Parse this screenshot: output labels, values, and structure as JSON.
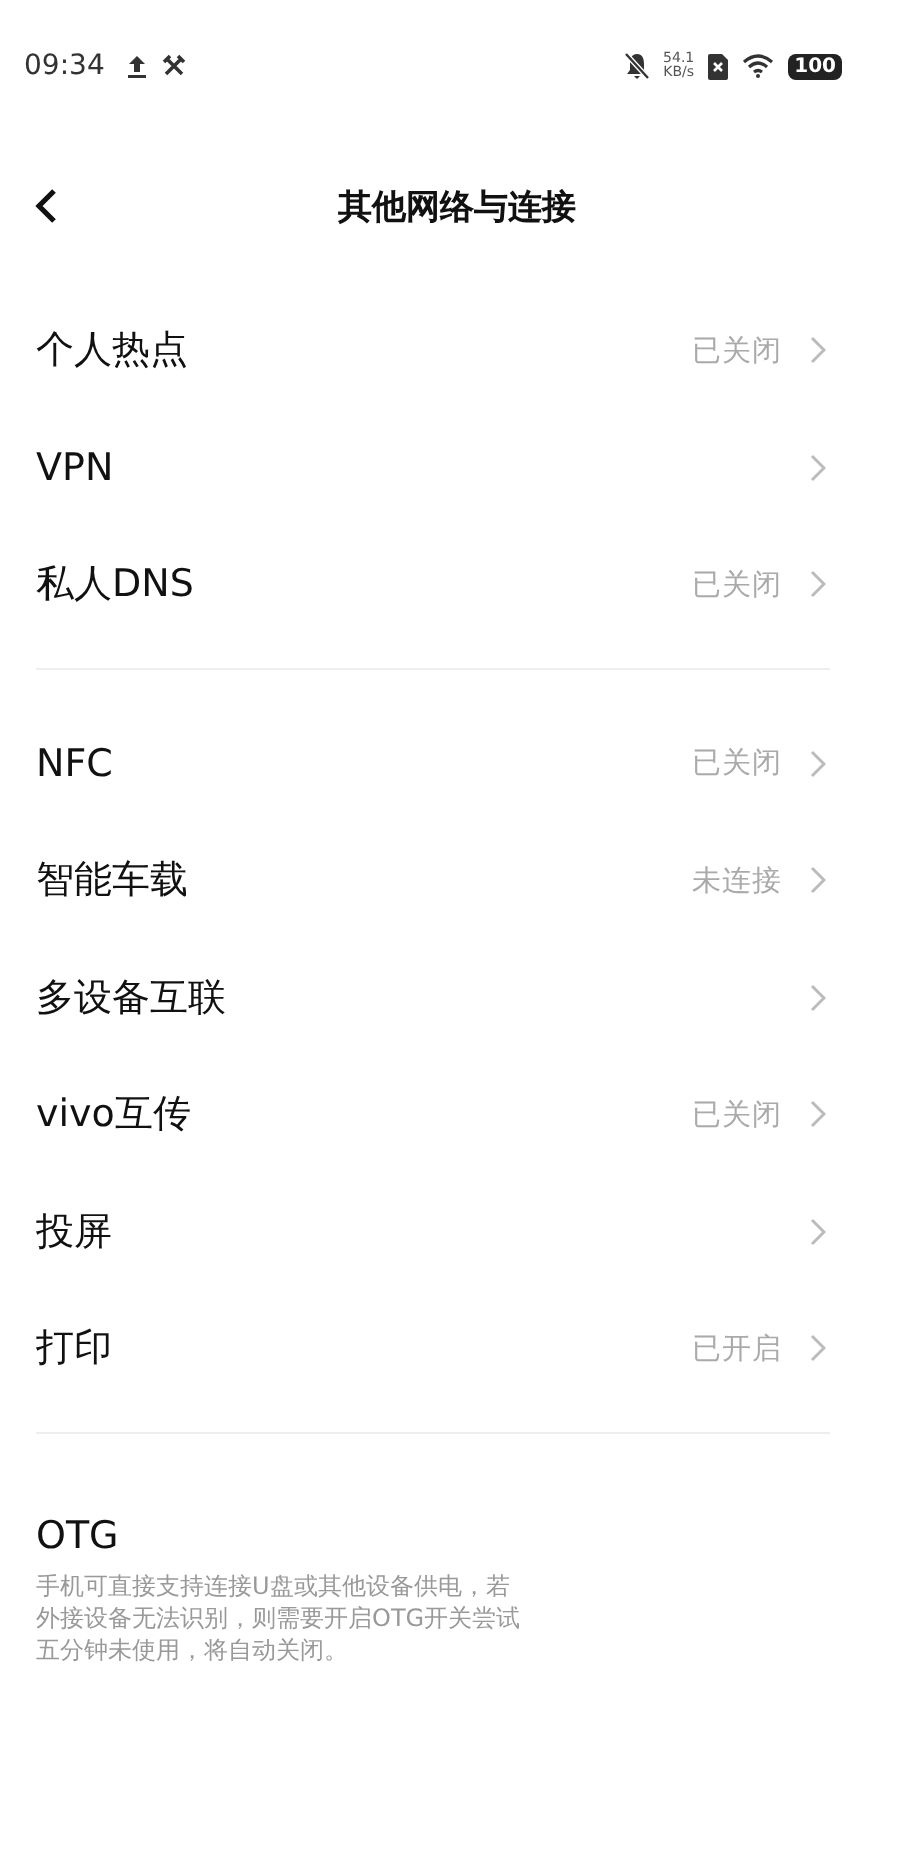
{
  "status_bar": {
    "time": "09:34",
    "speed_value": "54.1",
    "speed_unit": "KB/s",
    "battery": "100"
  },
  "header": {
    "title": "其他网络与连接"
  },
  "sections": [
    {
      "items": [
        {
          "label": "个人热点",
          "value": "已关闭"
        },
        {
          "label": "VPN"
        },
        {
          "label": "私人DNS",
          "value": "已关闭"
        }
      ]
    },
    {
      "items": [
        {
          "label": "NFC",
          "value": "已关闭"
        },
        {
          "label": "智能车载",
          "value": "未连接"
        },
        {
          "label": "多设备互联"
        },
        {
          "label": "vivo互传",
          "value": "已关闭"
        },
        {
          "label": "投屏"
        },
        {
          "label": "打印",
          "value": "已开启"
        }
      ]
    }
  ],
  "otg": {
    "title": "OTG",
    "description_lines": [
      "手机可直接支持连接U盘或其他设备供电，若",
      "外接设备无法识别，则需要开启OTG开关尝试",
      "五分钟未使用，将自动关闭。"
    ]
  }
}
